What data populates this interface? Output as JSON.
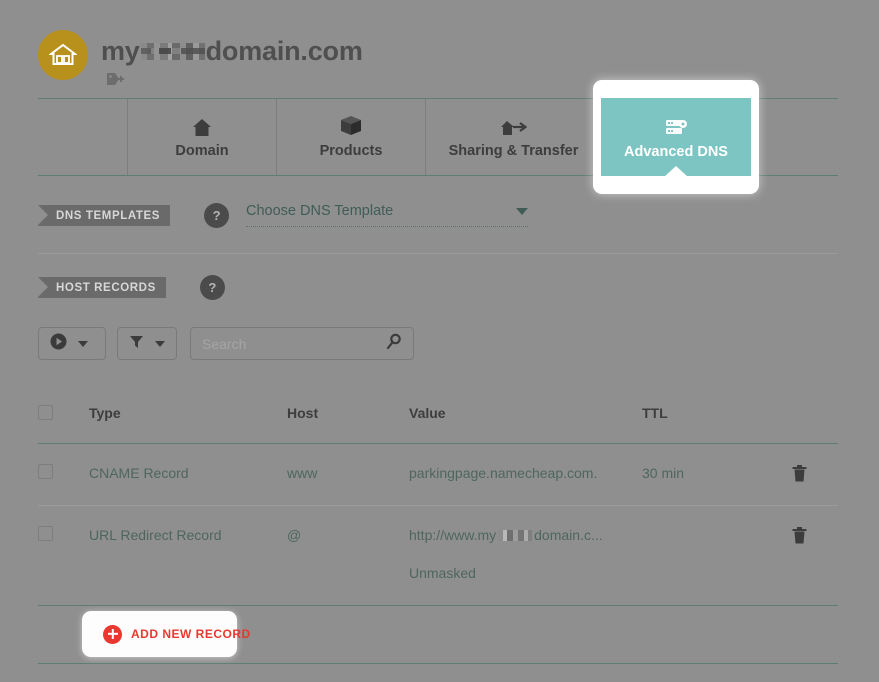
{
  "header": {
    "logo_icon": "home-circle-icon",
    "domain_prefix": "my",
    "domain_redacted": "[redacted]",
    "domain_suffix": "domain.com",
    "tag_icon": "tag-plus-icon"
  },
  "tabs": [
    {
      "id": "domain",
      "label": "Domain",
      "icon": "home-icon",
      "active": false
    },
    {
      "id": "products",
      "label": "Products",
      "icon": "box-icon",
      "active": false
    },
    {
      "id": "sharing",
      "label": "Sharing & Transfer",
      "icon": "house-arrow-icon",
      "active": false
    },
    {
      "id": "dns",
      "label": "Advanced DNS",
      "icon": "server-gear-icon",
      "active": true
    }
  ],
  "sections": {
    "dns_templates": {
      "title": "DNS TEMPLATES",
      "help_icon": "question-mark-icon",
      "help_label": "?",
      "select_value": "Choose DNS Template",
      "caret_icon": "chevron-down-icon"
    },
    "host_records": {
      "title": "HOST RECORDS",
      "help_icon": "question-mark-icon",
      "help_label": "?"
    }
  },
  "toolbar": {
    "action_button_icon": "play-circle-icon",
    "action_button_caret": "chevron-down-icon",
    "filter_button_icon": "funnel-icon",
    "filter_button_caret": "chevron-down-icon",
    "search_placeholder": "Search",
    "search_value": "",
    "search_icon": "search-icon"
  },
  "table": {
    "select_all_checkbox": "",
    "columns": [
      "Type",
      "Host",
      "Value",
      "TTL"
    ],
    "rows": [
      {
        "type": "CNAME Record",
        "host": "www",
        "value": "parkingpage.namecheap.com.",
        "value_suffix": "",
        "ttl": "30 min",
        "sub": "",
        "delete_icon": "trash-icon",
        "redacted": false
      },
      {
        "type": "URL Redirect Record",
        "host": "@",
        "value": "http://www.my",
        "value_suffix": "domain.c...",
        "ttl": "",
        "sub": "Unmasked",
        "delete_icon": "trash-icon",
        "redacted": true
      }
    ]
  },
  "add_record": {
    "label": "ADD NEW RECORD",
    "icon": "plus-circle-icon"
  },
  "colors": {
    "overlay_gray": "#8f8f8f",
    "teal": "#7cc5c2",
    "teal_line": "#5e7d77",
    "accent_red": "#e8382f",
    "logo_gold": "#b8901c",
    "text_dark": "#3d3d3d",
    "text_green": "#4e665f"
  }
}
